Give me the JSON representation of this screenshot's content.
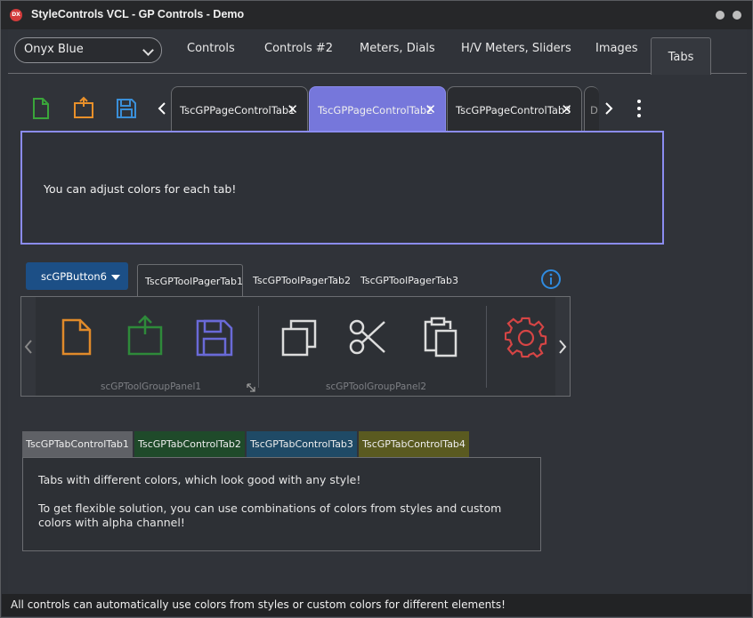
{
  "window": {
    "title": "StyleControls VCL - GP Controls - Demo",
    "icon_text": "DX"
  },
  "style_combo": {
    "value": "Onyx Blue"
  },
  "main_tabs": [
    {
      "label": "Controls"
    },
    {
      "label": "Controls #2"
    },
    {
      "label": "Meters, Dials"
    },
    {
      "label": "H/V Meters, Sliders"
    },
    {
      "label": "Images"
    },
    {
      "label": "Tabs",
      "active": true
    }
  ],
  "page_control": {
    "tabs": [
      {
        "label": "TscGPPageControlTab1"
      },
      {
        "label": "TscGPPageControlTab2",
        "active": true
      },
      {
        "label": "TscGPPageControlTab3"
      },
      {
        "label": "Di"
      }
    ],
    "close_glyph": "✕",
    "content": "You can adjust colors for each tab!",
    "active_color": "#7677db"
  },
  "tool_pager": {
    "button_label": "scGPButton6",
    "tabs": [
      {
        "label": "TscGPToolPagerTab1",
        "active": true
      },
      {
        "label": "TscGPToolPagerTab2"
      },
      {
        "label": "TscGPToolPagerTab3"
      }
    ],
    "groups": [
      {
        "label": "scGPToolGroupPanel1"
      },
      {
        "label": "scGPToolGroupPanel2"
      }
    ]
  },
  "tab_control": {
    "tabs": [
      {
        "label": "TscGPTabControlTab1",
        "color": "#5f6166"
      },
      {
        "label": "TscGPTabControlTab2",
        "color": "#1f4a2a"
      },
      {
        "label": "TscGPTabControlTab3",
        "color": "#1f4a66"
      },
      {
        "label": "TscGPTabControlTab4",
        "color": "#5a5a20"
      }
    ],
    "line1": "Tabs with different colors, which look good with any style!",
    "line2": "To get flexible solution, you can use combinations of colors from styles and custom colors with alpha channel!"
  },
  "status_bar": {
    "text": "All controls can automatically use colors from styles or custom colors for different elements!"
  },
  "icons": [
    "new-file-icon",
    "upload-file-icon",
    "save-icon",
    "copy-icon",
    "cut-icon",
    "paste-icon",
    "gear-icon",
    "info-icon"
  ]
}
